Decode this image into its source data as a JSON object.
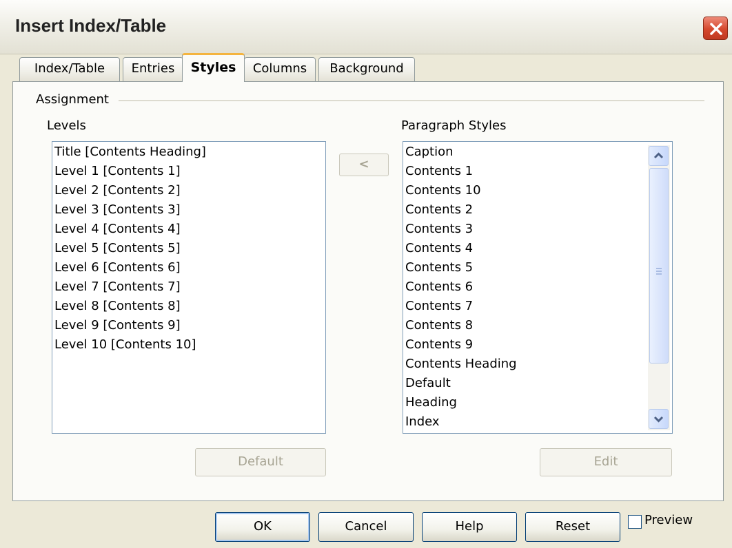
{
  "window": {
    "title": "Insert Index/Table"
  },
  "tabs": [
    {
      "label": "Index/Table",
      "active": false
    },
    {
      "label": "Entries",
      "active": false
    },
    {
      "label": "Styles",
      "active": true
    },
    {
      "label": "Columns",
      "active": false
    },
    {
      "label": "Background",
      "active": false
    }
  ],
  "assignment": {
    "group_label": "Assignment",
    "levels_label": "Levels",
    "levels": [
      "Title [Contents Heading]",
      "Level 1 [Contents 1]",
      "Level 2 [Contents 2]",
      "Level 3 [Contents 3]",
      "Level 4 [Contents 4]",
      "Level 5 [Contents 5]",
      "Level 6 [Contents 6]",
      "Level 7 [Contents 7]",
      "Level 8 [Contents 8]",
      "Level 9 [Contents 9]",
      "Level 10 [Contents 10]"
    ],
    "assign_button": "<",
    "styles_label": "Paragraph Styles",
    "styles": [
      "Caption",
      "Contents 1",
      "Contents 10",
      "Contents 2",
      "Contents 3",
      "Contents 4",
      "Contents 5",
      "Contents 6",
      "Contents 7",
      "Contents 8",
      "Contents 9",
      "Contents Heading",
      "Default",
      "Heading",
      "Index"
    ],
    "default_button": "Default",
    "edit_button": "Edit"
  },
  "footer": {
    "ok": "OK",
    "cancel": "Cancel",
    "help": "Help",
    "reset": "Reset",
    "preview_label": "Preview",
    "preview_checked": false
  }
}
